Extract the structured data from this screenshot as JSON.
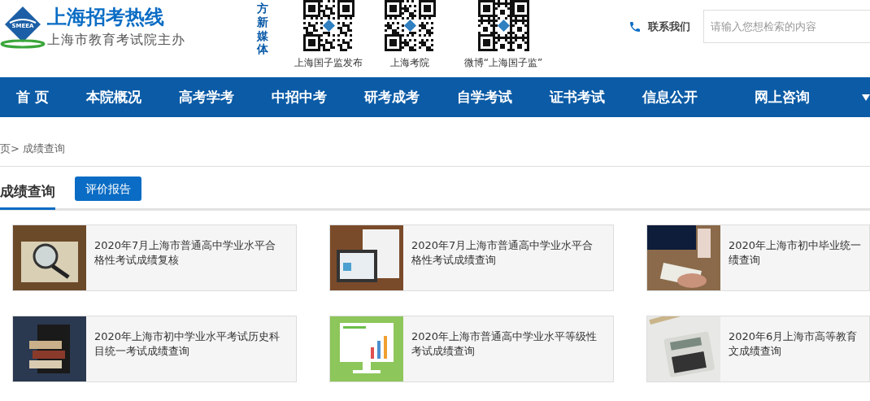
{
  "header": {
    "logo_text": "SMEEA",
    "title": "上海招考热线",
    "subtitle": "上海市教育考试院主办",
    "media_label": "方新媒体",
    "qr_codes": [
      {
        "label": "上海国子监发布"
      },
      {
        "label": "上海考院"
      },
      {
        "label": "微博“上海国子监”"
      }
    ],
    "contact": "联系我们",
    "search": {
      "placeholder": "请输入您想检索的内容"
    }
  },
  "nav": [
    {
      "label": "首 页"
    },
    {
      "label": "本院概况"
    },
    {
      "label": "高考学考"
    },
    {
      "label": "中招中考"
    },
    {
      "label": "研考成考"
    },
    {
      "label": "自学考试"
    },
    {
      "label": "证书考试"
    },
    {
      "label": "信息公开"
    },
    {
      "label": "网上咨询"
    }
  ],
  "breadcrumb": "页> 成绩查询",
  "tabs": [
    {
      "label": "成绩查询",
      "selected": true
    },
    {
      "label": "评价报告",
      "selected": false
    }
  ],
  "cards": [
    {
      "lines": [
        "2020年7月上海市普通高中学业水平合",
        "格性考试成绩复核"
      ]
    },
    {
      "lines": [
        "2020年7月上海市普通高中学业水平合",
        "格性考试成绩查询"
      ]
    },
    {
      "lines": [
        "2020年上海市初中毕业统一",
        "绩查询"
      ]
    },
    {
      "lines": [
        "2020年上海市初中学业水平考试历史科",
        "目统一考试成绩查询"
      ]
    },
    {
      "lines": [
        "2020年上海市普通高中学业水平等级性",
        "考试成绩查询"
      ]
    },
    {
      "lines": [
        "2020年6月上海市高等教育",
        "文成绩查询"
      ]
    }
  ]
}
